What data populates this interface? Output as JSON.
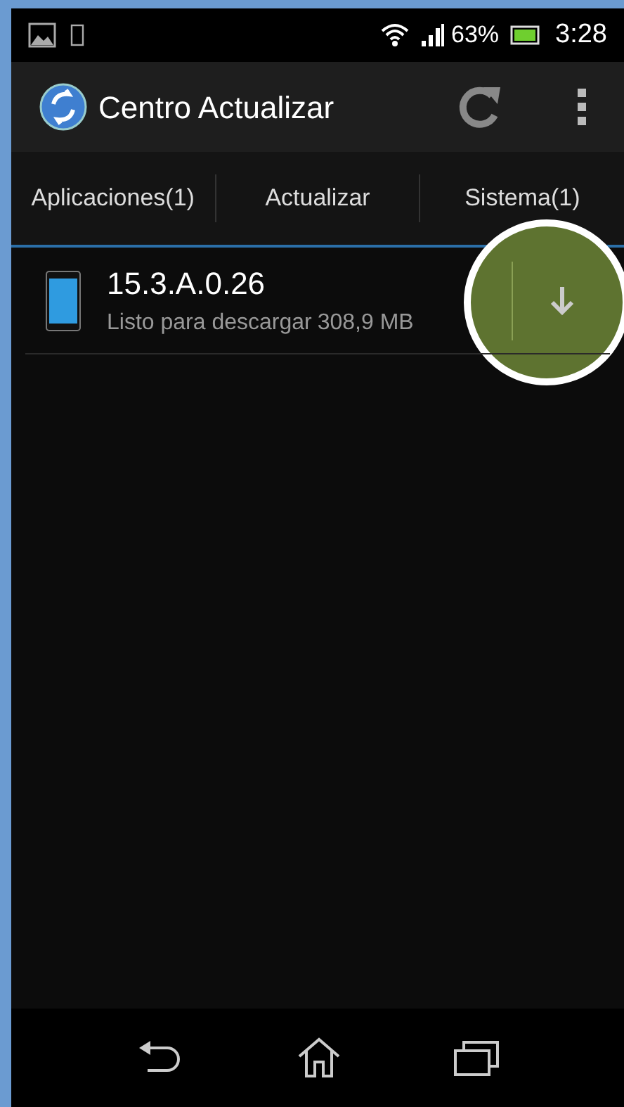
{
  "status_bar": {
    "battery_percent": "63%",
    "time": "3:28"
  },
  "action_bar": {
    "title": "Centro Actualizar"
  },
  "tabs": [
    {
      "label": "Aplicaciones(1)"
    },
    {
      "label": "Actualizar"
    },
    {
      "label": "Sistema(1)"
    }
  ],
  "updates": [
    {
      "name": "15.3.A.0.26",
      "status": "Listo para descargar",
      "size": "308,9 MB"
    }
  ],
  "highlight": {
    "shown": true
  }
}
